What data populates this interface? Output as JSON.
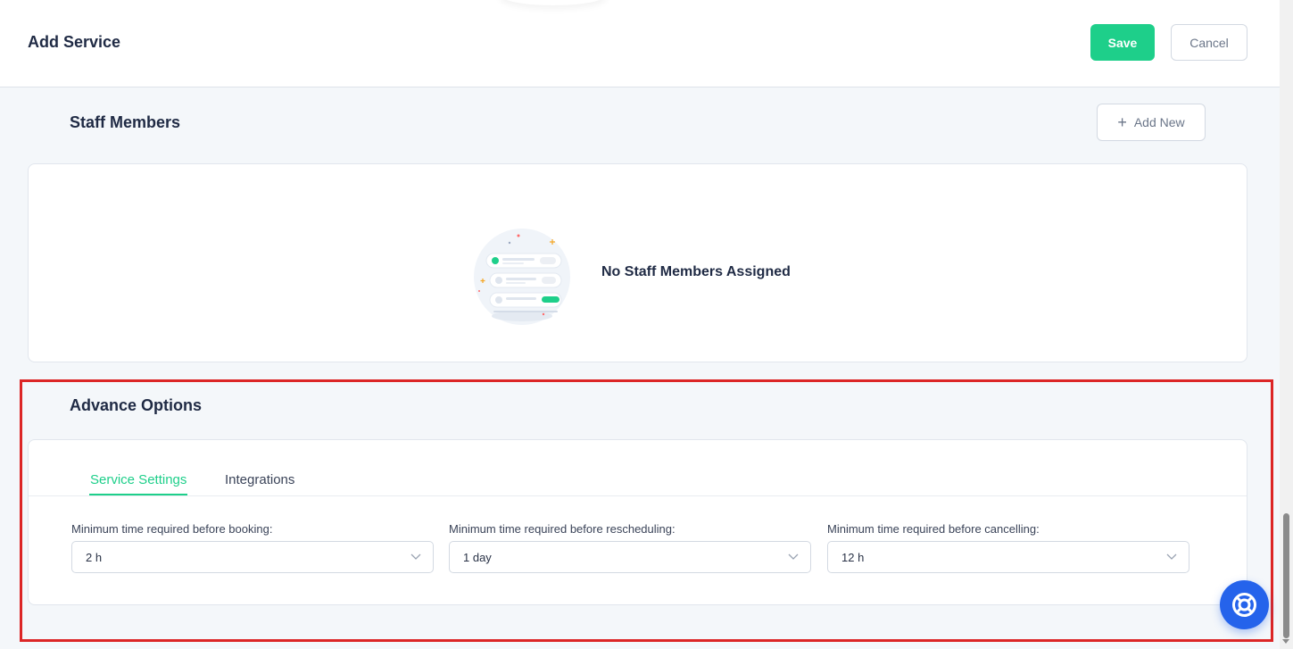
{
  "header": {
    "title": "Add Service",
    "save_label": "Save",
    "cancel_label": "Cancel"
  },
  "staff": {
    "title": "Staff Members",
    "add_new_label": "Add New",
    "empty_text": "No Staff Members Assigned"
  },
  "advance": {
    "title": "Advance Options",
    "tabs": [
      {
        "label": "Service Settings",
        "active": true
      },
      {
        "label": "Integrations",
        "active": false
      }
    ],
    "fields": [
      {
        "label": "Minimum time required before booking:",
        "value": "2 h"
      },
      {
        "label": "Minimum time required before rescheduling:",
        "value": "1 day"
      },
      {
        "label": "Minimum time required before cancelling:",
        "value": "12 h"
      }
    ]
  },
  "colors": {
    "accent": "#1ecf8a",
    "highlight": "#dc2626",
    "help": "#2563eb"
  },
  "icons": [
    "plus-icon",
    "staff-empty-illustration",
    "chevron-down-icon",
    "lifebuoy-icon"
  ]
}
